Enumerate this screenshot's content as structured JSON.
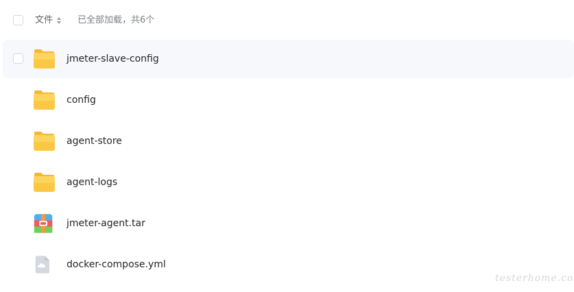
{
  "header": {
    "select_all_label": "",
    "sort_label": "文件",
    "status_text": "已全部加载，共6个"
  },
  "files": [
    {
      "name": "jmeter-slave-config",
      "type": "folder",
      "icon": "folder-icon"
    },
    {
      "name": "config",
      "type": "folder",
      "icon": "folder-icon"
    },
    {
      "name": "agent-store",
      "type": "folder",
      "icon": "folder-icon"
    },
    {
      "name": "agent-logs",
      "type": "folder",
      "icon": "folder-icon"
    },
    {
      "name": "jmeter-agent.tar",
      "type": "archive",
      "icon": "archive-icon"
    },
    {
      "name": "docker-compose.yml",
      "type": "file",
      "icon": "cloud-file-icon"
    }
  ],
  "watermark": "testerhome.com",
  "colors": {
    "folder": "#fcc844",
    "row_hover": "#f7f8fb",
    "text": "#25262b",
    "muted_text": "#7d7f84"
  }
}
